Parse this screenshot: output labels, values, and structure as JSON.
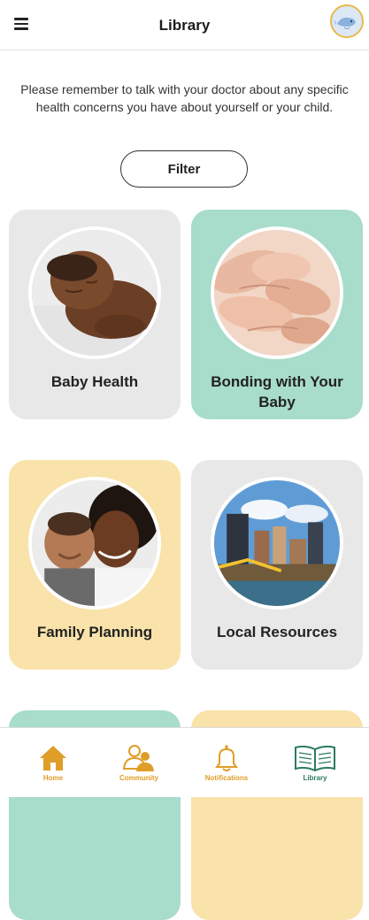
{
  "header": {
    "title": "Library"
  },
  "notice": "Please remember to talk with your doctor about any specific health concerns you have about yourself or your child.",
  "filter": {
    "label": "Filter"
  },
  "cards": [
    {
      "label": "Baby Health",
      "color": "#e8e8e8"
    },
    {
      "label": "Bonding with Your Baby",
      "color": "#a8dccb"
    },
    {
      "label": "Family Planning",
      "color": "#f9e3ab"
    },
    {
      "label": "Local Resources",
      "color": "#e8e8e8"
    }
  ],
  "bottom_nav": [
    {
      "label": "Home",
      "icon": "home-icon"
    },
    {
      "label": "Community",
      "icon": "community-icon"
    },
    {
      "label": "Notifications",
      "icon": "bell-icon"
    },
    {
      "label": "Library",
      "icon": "book-icon",
      "active": true
    }
  ],
  "colors": {
    "accent_orange": "#e09d27",
    "library_green": "#2d7a5f",
    "mint": "#a8dccb",
    "cream": "#f9e3ab",
    "gray": "#e8e8e8"
  }
}
